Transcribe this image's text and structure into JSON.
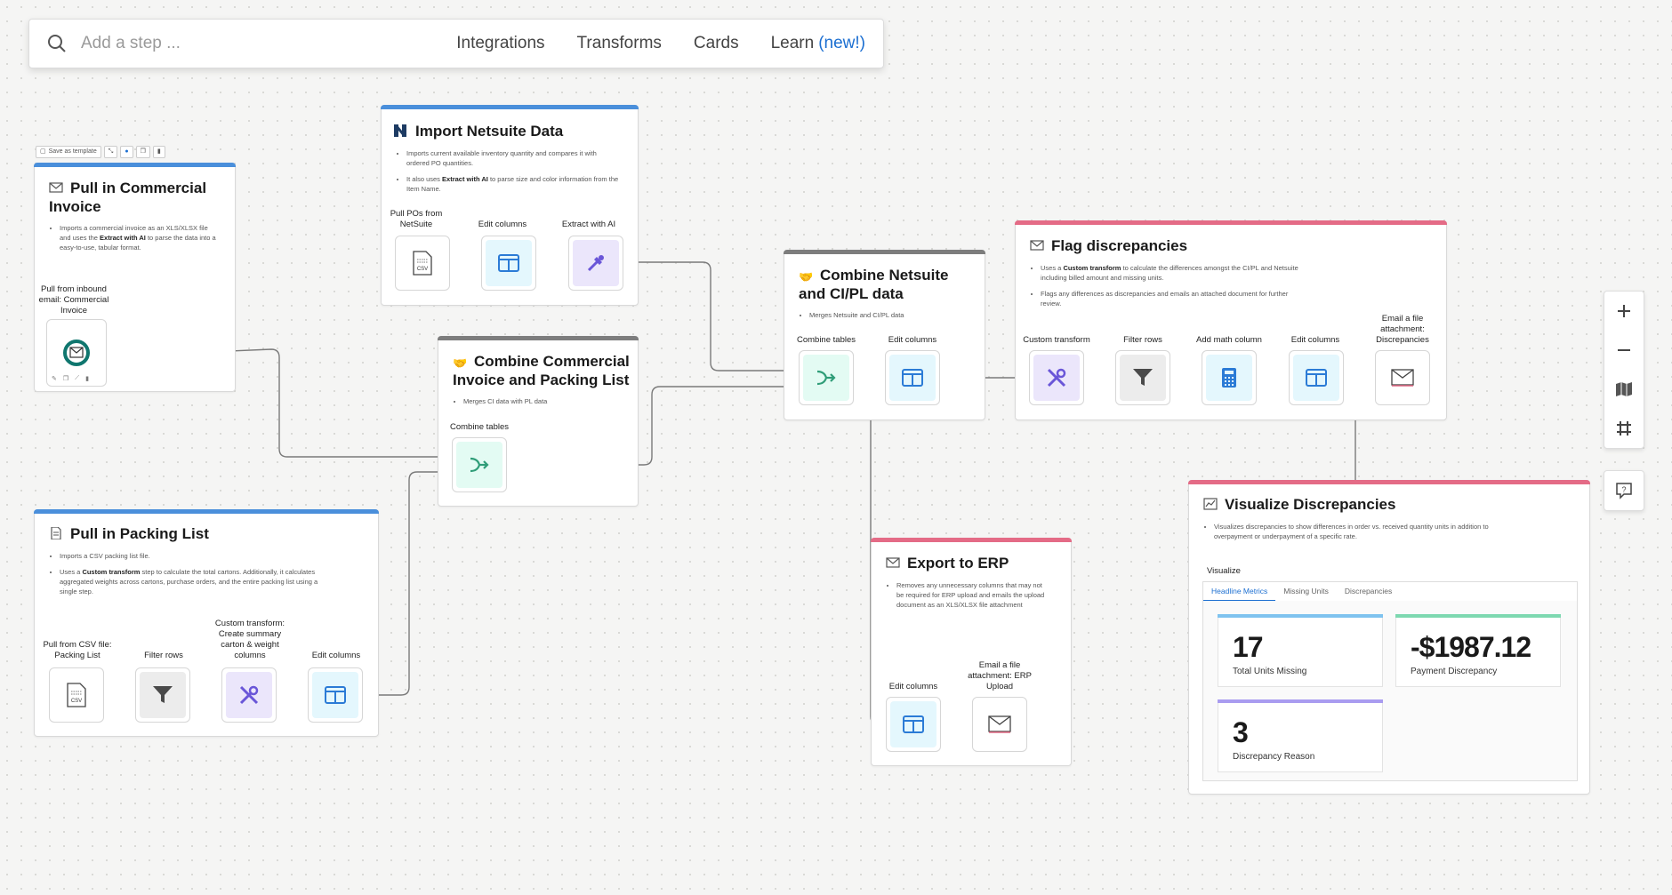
{
  "search": {
    "placeholder": "Add a step ..."
  },
  "nav": {
    "integrations": "Integrations",
    "transforms": "Transforms",
    "cards": "Cards",
    "learn": "Learn",
    "learn_badge": "(new!)"
  },
  "template_bar": {
    "save": "Save as template"
  },
  "cards": {
    "commercial_invoice": {
      "title": "Pull in Commercial Invoice",
      "desc_pre": "Imports a commercial invoice as an XLS/XLSX file and uses the ",
      "desc_bold": "Extract with AI",
      "desc_post": " to parse the data into a easy-to-use, tabular format.",
      "step_label": "Pull from inbound email: Commercial Invoice"
    },
    "netsuite": {
      "title": "Import Netsuite Data",
      "desc1": "Imports current available inventory quantity and compares it with ordered PO quantities.",
      "desc2_pre": "It also uses ",
      "desc2_bold": "Extract with AI",
      "desc2_post": " to parse size and color information from the Item Name.",
      "steps": [
        "Pull POs from NetSuite",
        "Edit columns",
        "Extract with AI"
      ]
    },
    "combine_ci_pl": {
      "title": "Combine Commercial Invoice and Packing List",
      "desc": "Merges CI data with PL data",
      "steps": [
        "Combine tables"
      ]
    },
    "packing_list": {
      "title": "Pull in Packing List",
      "desc1": "Imports a CSV packing list file.",
      "desc2_pre": "Uses a ",
      "desc2_bold": "Custom transform",
      "desc2_post": " step to calculate the total cartons. Additionally, it calculates aggregated weights across cartons, purchase orders, and the entire packing list using a single step.",
      "steps": [
        "Pull from CSV file: Packing List",
        "Filter rows",
        "Custom transform: Create summary carton & weight columns",
        "Edit columns"
      ]
    },
    "combine_netsuite": {
      "title": "Combine Netsuite and CI/PL data",
      "desc": "Merges Netsuite and CI/PL data",
      "steps": [
        "Combine tables",
        "Edit columns"
      ]
    },
    "flag": {
      "title": "Flag discrepancies",
      "desc1_pre": "Uses a ",
      "desc1_bold": "Custom transform",
      "desc1_post": " to calculate the differences amongst the CI/PL and Netsuite including billed amount and missing units.",
      "desc2": "Flags any differences as discrepancies and emails an attached document for further review.",
      "steps": [
        "Custom transform",
        "Filter rows",
        "Add math column",
        "Edit columns",
        "Email a file attachment: Discrepancies"
      ]
    },
    "export": {
      "title": "Export to ERP",
      "desc": "Removes any unnecessary columns that may not be required for ERP upload and emails the upload document as an XLS/XLSX file attachment",
      "steps": [
        "Edit columns",
        "Email a file attachment: ERP Upload"
      ]
    },
    "visualize": {
      "title": "Visualize Discrepancies",
      "desc": "Visualizes discrepancies to show differences in order vs. received quantity units in addition to overpayment or underpayment of a specific rate.",
      "section": "Visualize",
      "tabs": [
        "Headline Metrics",
        "Missing Units",
        "Discrepancies"
      ],
      "metrics": [
        {
          "value": "17",
          "label": "Total Units Missing",
          "color": "#7fc3ef"
        },
        {
          "value": "-$1987.12",
          "label": "Payment Discrepancy",
          "color": "#7dd8b0"
        },
        {
          "value": "3",
          "label": "Discrepancy Reason",
          "color": "#a99cf0"
        }
      ]
    }
  },
  "colors": {
    "blue": "#4a8fdb",
    "pink": "#e46b86",
    "gray": "#7d7d7d",
    "accent": "#1c6fd1"
  }
}
